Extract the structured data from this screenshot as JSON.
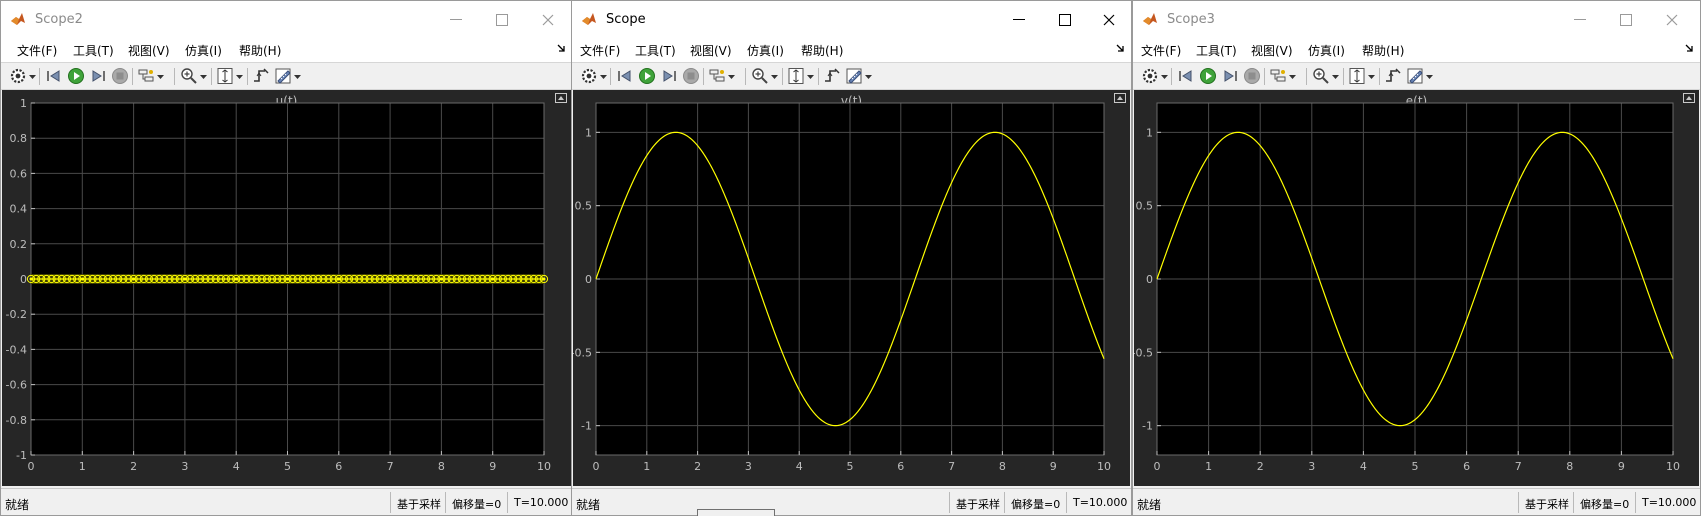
{
  "windows": [
    {
      "id": "scope2",
      "title": "Scope2",
      "active": false,
      "menu": [
        "文件(F)",
        "工具(T)",
        "视图(V)",
        "仿真(I)",
        "帮助(H)"
      ],
      "plot": {
        "title": "u(t)",
        "x_ticks": [
          "0",
          "1",
          "2",
          "3",
          "4",
          "5",
          "6",
          "7",
          "8",
          "9",
          "10"
        ],
        "y_ticks": [
          "1",
          "0.8",
          "0.6",
          "0.4",
          "0.2",
          "0",
          "-0.2",
          "-0.4",
          "-0.6",
          "-0.8",
          "-1"
        ]
      },
      "status": {
        "ready": "就绪",
        "sample": "基于采样",
        "offset": "偏移量=0",
        "time": "T=10.000"
      }
    },
    {
      "id": "scope",
      "title": "Scope",
      "active": true,
      "menu": [
        "文件(F)",
        "工具(T)",
        "视图(V)",
        "仿真(I)",
        "帮助(H)"
      ],
      "plot": {
        "title": "v(t)",
        "x_ticks": [
          "0",
          "1",
          "2",
          "3",
          "4",
          "5",
          "6",
          "7",
          "8",
          "9",
          "10"
        ],
        "y_ticks": [
          "1",
          "0.5",
          "0",
          "-0.5",
          "-1"
        ]
      },
      "status": {
        "ready": "就绪",
        "sample": "基于采样",
        "offset": "偏移量=0",
        "time": "T=10.000"
      }
    },
    {
      "id": "scope3",
      "title": "Scope3",
      "active": false,
      "menu": [
        "文件(F)",
        "工具(T)",
        "视图(V)",
        "仿真(I)",
        "帮助(H)"
      ],
      "plot": {
        "title": "e(t)",
        "x_ticks": [
          "0",
          "1",
          "2",
          "3",
          "4",
          "5",
          "6",
          "7",
          "8",
          "9",
          "10"
        ],
        "y_ticks": [
          "1",
          "0.5",
          "0",
          "-0.5",
          "-1"
        ]
      },
      "status": {
        "ready": "就绪",
        "sample": "基于采样",
        "offset": "偏移量=0",
        "time": "T=10.000"
      }
    }
  ],
  "chart_data": [
    {
      "type": "line",
      "title": "u(t)",
      "xlim": [
        0,
        10
      ],
      "ylim": [
        -1,
        1
      ],
      "grid": true,
      "background": "#000000",
      "line_color": "#ffff00",
      "marker": "circle",
      "series": [
        {
          "x": [
            0,
            1,
            2,
            3,
            4,
            5,
            6,
            7,
            8,
            9,
            10
          ],
          "y": [
            0,
            0,
            0,
            0,
            0,
            0,
            0,
            0,
            0,
            0,
            0
          ]
        }
      ]
    },
    {
      "type": "line",
      "title": "v(t)",
      "xlim": [
        0,
        10
      ],
      "ylim": [
        -1.2,
        1.2
      ],
      "grid": true,
      "background": "#000000",
      "line_color": "#ffff00",
      "series": [
        {
          "x": [
            0,
            0.5,
            1,
            1.57,
            2,
            2.5,
            3,
            3.5,
            4,
            4.71,
            5,
            5.5,
            6,
            6.5,
            7,
            7.85,
            8,
            8.5,
            9,
            9.5,
            10
          ],
          "y": [
            0,
            0.48,
            0.84,
            1.0,
            0.91,
            0.6,
            0.14,
            -0.35,
            -0.76,
            -1.0,
            -0.96,
            -0.71,
            -0.28,
            0.22,
            0.66,
            1.0,
            0.99,
            0.8,
            0.41,
            -0.08,
            -0.54
          ]
        }
      ]
    },
    {
      "type": "line",
      "title": "e(t)",
      "xlim": [
        0,
        10
      ],
      "ylim": [
        -1.2,
        1.2
      ],
      "grid": true,
      "background": "#000000",
      "line_color": "#ffff00",
      "series": [
        {
          "x": [
            0,
            0.5,
            1,
            1.57,
            2,
            2.5,
            3,
            3.5,
            4,
            4.71,
            5,
            5.5,
            6,
            6.5,
            7,
            7.85,
            8,
            8.5,
            9,
            9.5,
            10
          ],
          "y": [
            0,
            0.48,
            0.84,
            1.0,
            0.91,
            0.6,
            0.14,
            -0.35,
            -0.76,
            -1.0,
            -0.96,
            -0.71,
            -0.28,
            0.22,
            0.66,
            1.0,
            0.99,
            0.8,
            0.41,
            -0.08,
            -0.54
          ]
        }
      ]
    }
  ],
  "icons": {
    "app": "matlab-logo-icon",
    "toolbar": [
      "settings-icon",
      "step-back-icon",
      "run-icon",
      "step-forward-icon",
      "stop-icon",
      "highlight-icon",
      "zoom-in-icon",
      "scale-axes-icon",
      "trigger-icon",
      "measure-icon"
    ]
  },
  "colors": {
    "accent_green": "#3fa33a",
    "plot_bg": "#000000",
    "panel_bg": "#262626",
    "trace": "#ffff00"
  }
}
